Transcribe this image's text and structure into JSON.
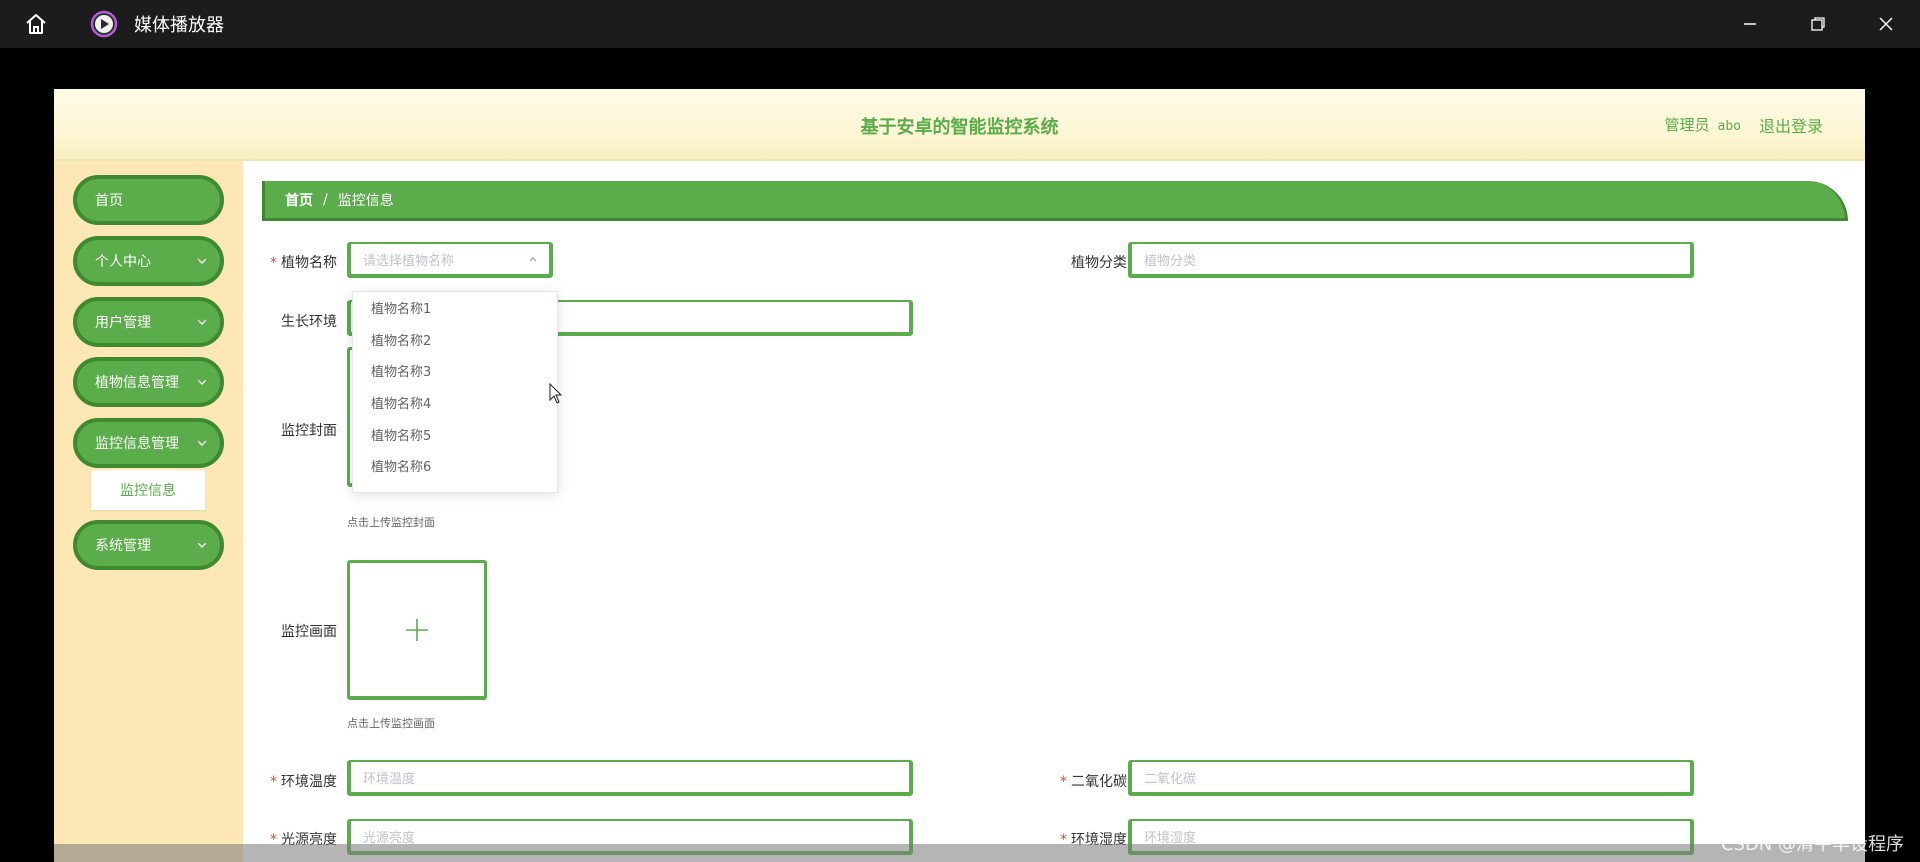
{
  "window": {
    "title": "媒体播放器",
    "icons": [
      "home-icon",
      "media-player-icon",
      "minimize-icon",
      "restore-icon",
      "close-icon"
    ]
  },
  "header": {
    "title": "基于安卓的智能监控系统",
    "user_role": "管理员",
    "user_name": "abo",
    "logout_label": "退出登录"
  },
  "sidebar": {
    "items": [
      {
        "label": "首页",
        "has_children": false
      },
      {
        "label": "个人中心",
        "has_children": true
      },
      {
        "label": "用户管理",
        "has_children": true
      },
      {
        "label": "植物信息管理",
        "has_children": true
      },
      {
        "label": "监控信息管理",
        "has_children": true
      },
      {
        "label": "系统管理",
        "has_children": true
      }
    ],
    "active_submenu": "监控信息"
  },
  "breadcrumb": {
    "home": "首页",
    "separator": "/",
    "current": "监控信息"
  },
  "form": {
    "plant_name": {
      "label": "植物名称",
      "required": true,
      "placeholder": "请选择植物名称"
    },
    "plant_category": {
      "label": "植物分类",
      "required": false,
      "placeholder": "植物分类"
    },
    "growth_env": {
      "label": "生长环境",
      "required": false,
      "placeholder": ""
    },
    "cover": {
      "label": "监控封面",
      "hint": "点击上传监控封面"
    },
    "screen": {
      "label": "监控画面",
      "hint": "点击上传监控画面"
    },
    "temperature": {
      "label": "环境温度",
      "required": true,
      "placeholder": "环境温度"
    },
    "co2": {
      "label": "二氧化碳",
      "required": true,
      "placeholder": "二氧化碳"
    },
    "light": {
      "label": "光源亮度",
      "required": true,
      "placeholder": "光源亮度"
    },
    "humidity": {
      "label": "环境湿度",
      "required": true,
      "placeholder": "环境湿度"
    }
  },
  "dropdown": {
    "options": [
      "植物名称1",
      "植物名称2",
      "植物名称3",
      "植物名称4",
      "植物名称5",
      "植物名称6"
    ]
  },
  "watermark": "CSDN @清平毕设程序",
  "colors": {
    "accent_green": "#5aad4a",
    "dark_green": "#3f8a30",
    "sidebar_bg": "#fde7b4",
    "header_bg": "#fdf7d6",
    "required_red": "#e64a3a"
  }
}
